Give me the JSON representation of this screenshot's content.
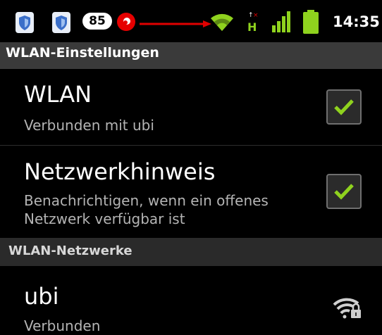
{
  "status_bar": {
    "notification_icons": [
      "shield-icon",
      "shield-icon"
    ],
    "badge_count": "85",
    "carrier_icon": "vodafone-icon",
    "annotation_arrow_color": "#e00000",
    "wifi_icon": "wifi-signal-icon",
    "data_icon": "hplus-data-icon",
    "signal_icon": "cell-signal-icon",
    "battery_icon": "battery-icon",
    "time": "14:35",
    "accent_color": "#8fd21e"
  },
  "screen": {
    "title": "WLAN-Einstellungen"
  },
  "settings": [
    {
      "title": "WLAN",
      "summary": "Verbunden mit ubi",
      "checked": true
    },
    {
      "title": "Netzwerkhinweis",
      "summary_line1": "Benachrichtigen, wenn ein offenes",
      "summary_line2": "Netzwerk verfügbar ist",
      "checked": true
    }
  ],
  "networks_section": {
    "header": "WLAN-Netzwerke",
    "networks": [
      {
        "ssid": "ubi",
        "status": "Verbunden",
        "icon": "wifi-locked-icon"
      }
    ]
  }
}
